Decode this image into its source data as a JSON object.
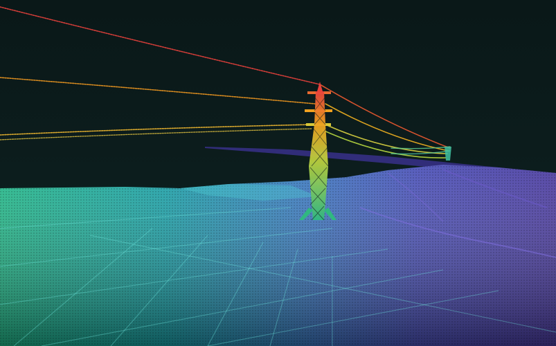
{
  "scene": {
    "subject": "lidar-point-cloud",
    "colors": {
      "sky": "#0c1c1c",
      "sky_top": "#0a1818",
      "elevation_high": "#e8413c",
      "elevation_mid_high": "#f0a020",
      "elevation_mid": "#c8d840",
      "elevation_mid_low": "#38c8a0",
      "elevation_low": "#10a8b0",
      "terrain_far": "#4838a8",
      "terrain_ridge": "#6650c8",
      "terrain_near": "#1890a8"
    }
  }
}
